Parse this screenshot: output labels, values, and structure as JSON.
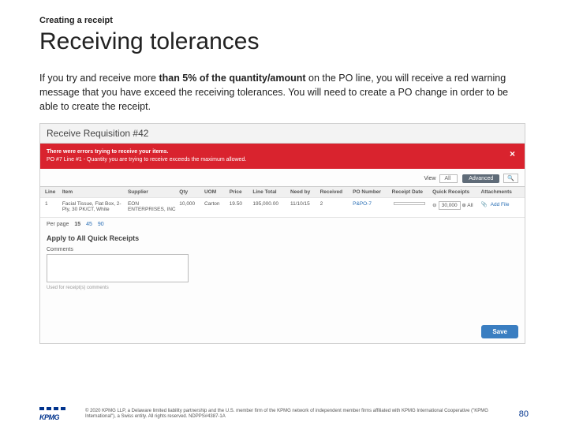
{
  "eyebrow": "Creating a receipt",
  "title": "Receiving tolerances",
  "body_pre": "If you try and receive more ",
  "body_bold": "than 5% of the quantity/amount",
  "body_post": " on the PO line, you will receive a red warning message that you have exceed the receiving tolerances. You will need to create a PO change in order to be able to create the receipt.",
  "screenshot": {
    "window_title": "Receive Requisition #42",
    "error_title": "There were errors trying to receive your items.",
    "error_detail": "PO #7 Line #1 - Quantity you are trying to receive exceeds the maximum allowed.",
    "view_label": "View",
    "view_value": "All",
    "btn_advanced": "Advanced",
    "headers": {
      "line": "Line",
      "item": "Item",
      "supplier": "Supplier",
      "qty": "Qty",
      "uom": "UOM",
      "price": "Price",
      "total": "Line Total",
      "needby": "Need by",
      "received": "Received",
      "po": "PO Number",
      "rdate": "Receipt Date",
      "qr": "Quick Receipts",
      "att": "Attachments"
    },
    "row": {
      "line": "1",
      "item": "Facial Tissue, Flat Box, 2-Ply, 30 PK/CT, White",
      "supplier": "EON ENTERPRISES, INC",
      "qty": "10,000",
      "uom": "Carton",
      "price": "19.50",
      "total": "195,000.00",
      "needby": "11/10/15",
      "received": "2",
      "po": "P&PO-7",
      "rdate": "",
      "qr_val": "30,000",
      "att_note": "Add File"
    },
    "pager_label": "Per page",
    "pager_15": "15",
    "pager_45": "45",
    "pager_90": "90",
    "apply_title": "Apply to All Quick Receipts",
    "comments_label": "Comments",
    "hint": "Used for receipt(s) comments",
    "save": "Save"
  },
  "footer": {
    "logo": "KPMG",
    "disclaimer": "© 2020 KPMG LLP, a Delaware limited liability partnership and the U.S. member firm of the KPMG network of independent member firms affiliated with KPMG International Cooperative (\"KPMG International\"), a Swiss entity. All rights reserved. NDPPS#4387-1A",
    "page": "80"
  }
}
